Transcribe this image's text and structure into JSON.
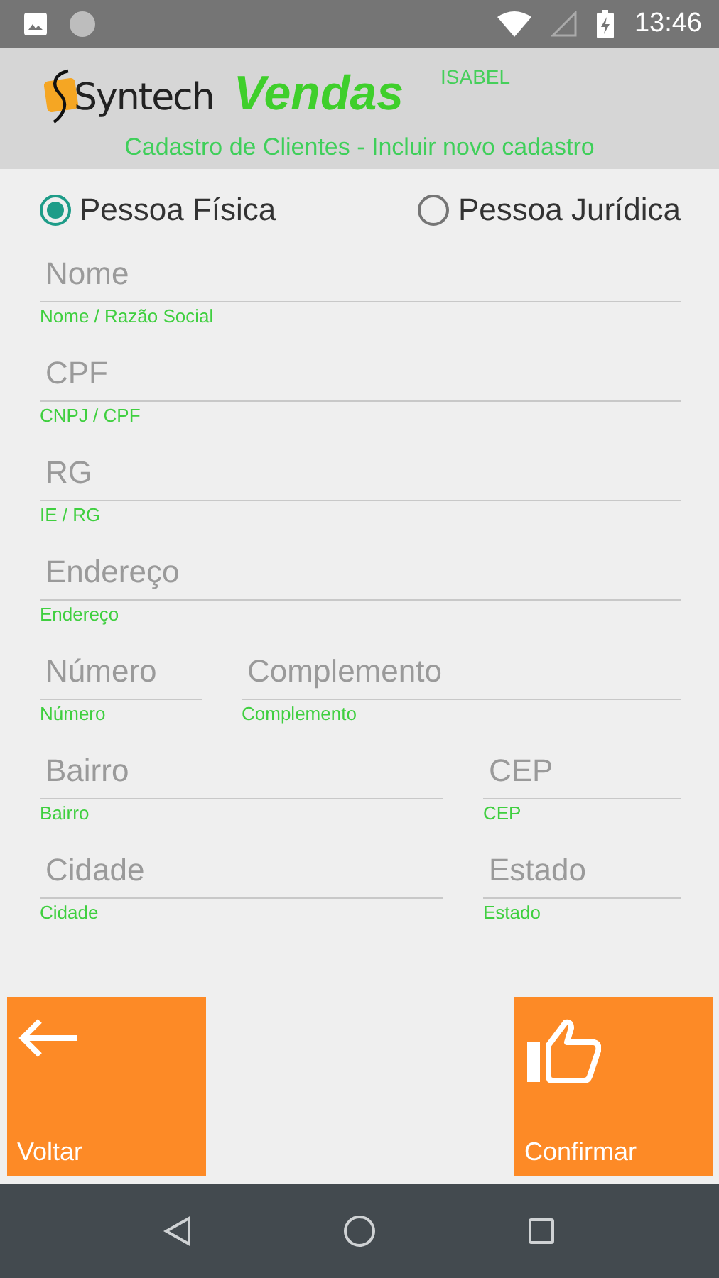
{
  "status_bar": {
    "time": "13:46"
  },
  "header": {
    "logo": "Syntech",
    "app_name": "Vendas",
    "user": "ISABEL",
    "subtitle": "Cadastro de Clientes - Incluir novo cadastro"
  },
  "person_type": [
    {
      "label": "Pessoa Física",
      "selected": true
    },
    {
      "label": "Pessoa Jurídica",
      "selected": false
    }
  ],
  "rows": [
    {
      "kind": "single",
      "fields": [
        {
          "placeholder": "Nome",
          "caption": "Nome / Razão Social"
        }
      ]
    },
    {
      "kind": "single",
      "fields": [
        {
          "placeholder": "CPF",
          "caption": "CNPJ / CPF"
        }
      ]
    },
    {
      "kind": "single",
      "fields": [
        {
          "placeholder": "RG",
          "caption": "IE / RG"
        }
      ]
    },
    {
      "kind": "single",
      "fields": [
        {
          "placeholder": "Endereço",
          "caption": "Endereço"
        }
      ]
    },
    {
      "kind": "left-narrow",
      "fields": [
        {
          "placeholder": "Número",
          "caption": "Número"
        },
        {
          "placeholder": "Complemento",
          "caption": "Complemento"
        }
      ]
    },
    {
      "kind": "right-narrow",
      "fields": [
        {
          "placeholder": "Bairro",
          "caption": "Bairro"
        },
        {
          "placeholder": "CEP",
          "caption": "CEP"
        }
      ]
    },
    {
      "kind": "right-narrow",
      "fields": [
        {
          "placeholder": "Cidade",
          "caption": "Cidade"
        },
        {
          "placeholder": "Estado",
          "caption": "Estado"
        }
      ]
    }
  ],
  "buttons": [
    {
      "kind": "back",
      "label": "Voltar"
    },
    {
      "kind": "confirm",
      "label": "Confirmar"
    }
  ]
}
